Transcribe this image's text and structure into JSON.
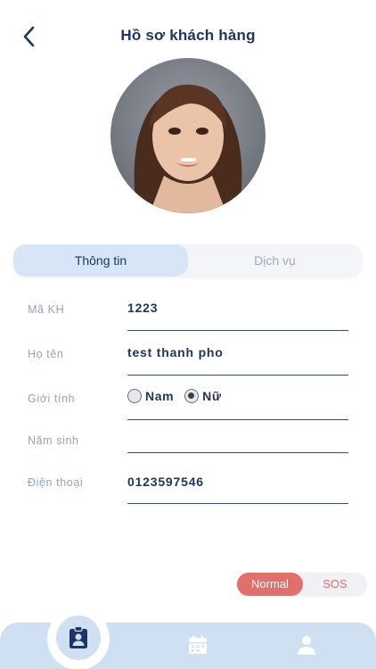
{
  "header": {
    "title": "Hồ sơ khách hàng"
  },
  "tabs": [
    {
      "label": "Thông tin",
      "active": true
    },
    {
      "label": "Dịch vụ",
      "active": false
    }
  ],
  "form": {
    "customer_id": {
      "label": "Mã KH",
      "value": "1223"
    },
    "full_name": {
      "label": "Họ tên",
      "value": "test thanh pho"
    },
    "gender": {
      "label": "Giới tính",
      "options": [
        "Nam",
        "Nữ"
      ],
      "selected": "Nữ"
    },
    "birth_year": {
      "label": "Năm sinh",
      "value": ""
    },
    "phone": {
      "label": "Điện thoại",
      "value": "0123597546"
    }
  },
  "mode": {
    "normal_label": "Normal",
    "sos_label": "SOS",
    "active": "Normal"
  },
  "nav": {
    "items": [
      "profile-card-icon",
      "calendar-icon",
      "person-icon"
    ]
  },
  "colors": {
    "primary": "#1f3561",
    "accent": "#e26f6a",
    "tab_active": "#d6e6f7",
    "nav_bg": "#cfe0f2"
  }
}
